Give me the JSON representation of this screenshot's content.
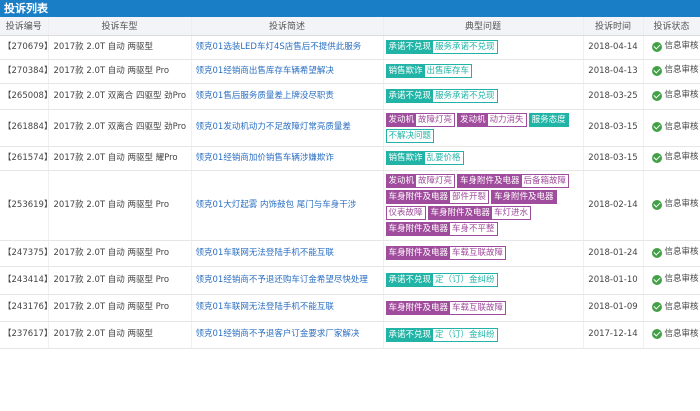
{
  "page_title": "投诉列表",
  "columns": {
    "id": "投诉编号",
    "model": "投诉车型",
    "desc": "投诉简述",
    "issues": "典型问题",
    "time": "投诉时间",
    "status": "投诉状态"
  },
  "colors": {
    "header_blue": "#1a7ec6",
    "teal": "#21b4a6",
    "purple": "#a04c9c",
    "link": "#2b6fc2",
    "check_green": "#43a047"
  },
  "rows": [
    {
      "id": "【270679】",
      "model": "2017款 2.0T 自动 两驱型",
      "desc": "领克01选装LED车灯4S店售后不提供此服务",
      "issues": [
        {
          "cat": "承诺不兑现",
          "sub": "服务承诺不兑现",
          "color": "teal"
        }
      ],
      "time": "2018-04-14",
      "status": "信息审核"
    },
    {
      "id": "【270384】",
      "model": "2017款 2.0T 自动 两驱型 Pro",
      "desc": "领克01经销商出售库存车辆希望解决",
      "issues": [
        {
          "cat": "销售欺诈",
          "sub": "出售库存车",
          "color": "teal"
        }
      ],
      "time": "2018-04-13",
      "status": "信息审核"
    },
    {
      "id": "【265008】",
      "model": "2017款 2.0T 双离合 四驱型 劲Pro",
      "desc": "领克01售后服务质量差上牌没尽职责",
      "issues": [
        {
          "cat": "承诺不兑现",
          "sub": "服务承诺不兑现",
          "color": "teal"
        }
      ],
      "time": "2018-03-25",
      "status": "信息审核"
    },
    {
      "id": "【261884】",
      "model": "2017款 2.0T 双离合 四驱型 劲Pro",
      "desc": "领克01发动机动力不足故障灯常亮质量差",
      "issues": [
        {
          "cat": "发动机",
          "sub": "故障灯亮",
          "color": "purple"
        },
        {
          "cat": "发动机",
          "sub": "动力消失",
          "color": "purple"
        },
        {
          "cat": "服务态度",
          "sub": "",
          "color": "teal"
        },
        {
          "cat": "",
          "sub": "不解决问题",
          "color": "teal"
        }
      ],
      "time": "2018-03-15",
      "status": "信息审核"
    },
    {
      "id": "【261574】",
      "model": "2017款 2.0T 自动 两驱型 耀Pro",
      "desc": "领克01经销商加价销售车辆涉嫌欺诈",
      "issues": [
        {
          "cat": "销售欺诈",
          "sub": "乱要价格",
          "color": "teal"
        }
      ],
      "time": "2018-03-15",
      "status": "信息审核"
    },
    {
      "id": "【253619】",
      "model": "2017款 2.0T 自动 两驱型 Pro",
      "desc": "领克01大灯起雾 内饰鼓包 尾门与车身干涉",
      "issues": [
        {
          "cat": "发动机",
          "sub": "故障灯亮",
          "color": "purple"
        },
        {
          "cat": "车身附件及电器",
          "sub": "后备箱故障",
          "color": "purple"
        },
        {
          "cat": "车身附件及电器",
          "sub": "部件开裂",
          "color": "purple"
        },
        {
          "cat": "车身附件及电器",
          "sub": "",
          "color": "purple"
        },
        {
          "cat": "",
          "sub": "仪表故障",
          "color": "purple"
        },
        {
          "cat": "车身附件及电器",
          "sub": "车灯进水",
          "color": "purple"
        },
        {
          "cat": "车身附件及电器",
          "sub": "车身不平整",
          "color": "purple"
        }
      ],
      "time": "2018-02-14",
      "status": "信息审核"
    },
    {
      "id": "【247375】",
      "model": "2017款 2.0T 自动 两驱型 Pro",
      "desc": "领克01车联网无法登陆手机不能互联",
      "issues": [
        {
          "cat": "车身附件及电器",
          "sub": "车载互联故障",
          "color": "purple"
        }
      ],
      "time": "2018-01-24",
      "status": "信息审核"
    },
    {
      "id": "【243414】",
      "model": "2017款 2.0T 自动 两驱型 Pro",
      "desc": "领克01经销商不予退还购车订金希望尽快处理",
      "issues": [
        {
          "cat": "承诺不兑现",
          "sub": "定（订）金纠纷",
          "color": "teal"
        }
      ],
      "time": "2018-01-10",
      "status": "信息审核"
    },
    {
      "id": "【243176】",
      "model": "2017款 2.0T 自动 两驱型 Pro",
      "desc": "领克01车联网无法登陆手机不能互联",
      "issues": [
        {
          "cat": "车身附件及电器",
          "sub": "车载互联故障",
          "color": "purple"
        }
      ],
      "time": "2018-01-09",
      "status": "信息审核"
    },
    {
      "id": "【237617】",
      "model": "2017款 2.0T 自动 两驱型",
      "desc": "领克01经销商不予退客户订金要求厂家解决",
      "issues": [
        {
          "cat": "承诺不兑现",
          "sub": "定（订）金纠纷",
          "color": "teal"
        }
      ],
      "time": "2017-12-14",
      "status": "信息审核"
    }
  ]
}
